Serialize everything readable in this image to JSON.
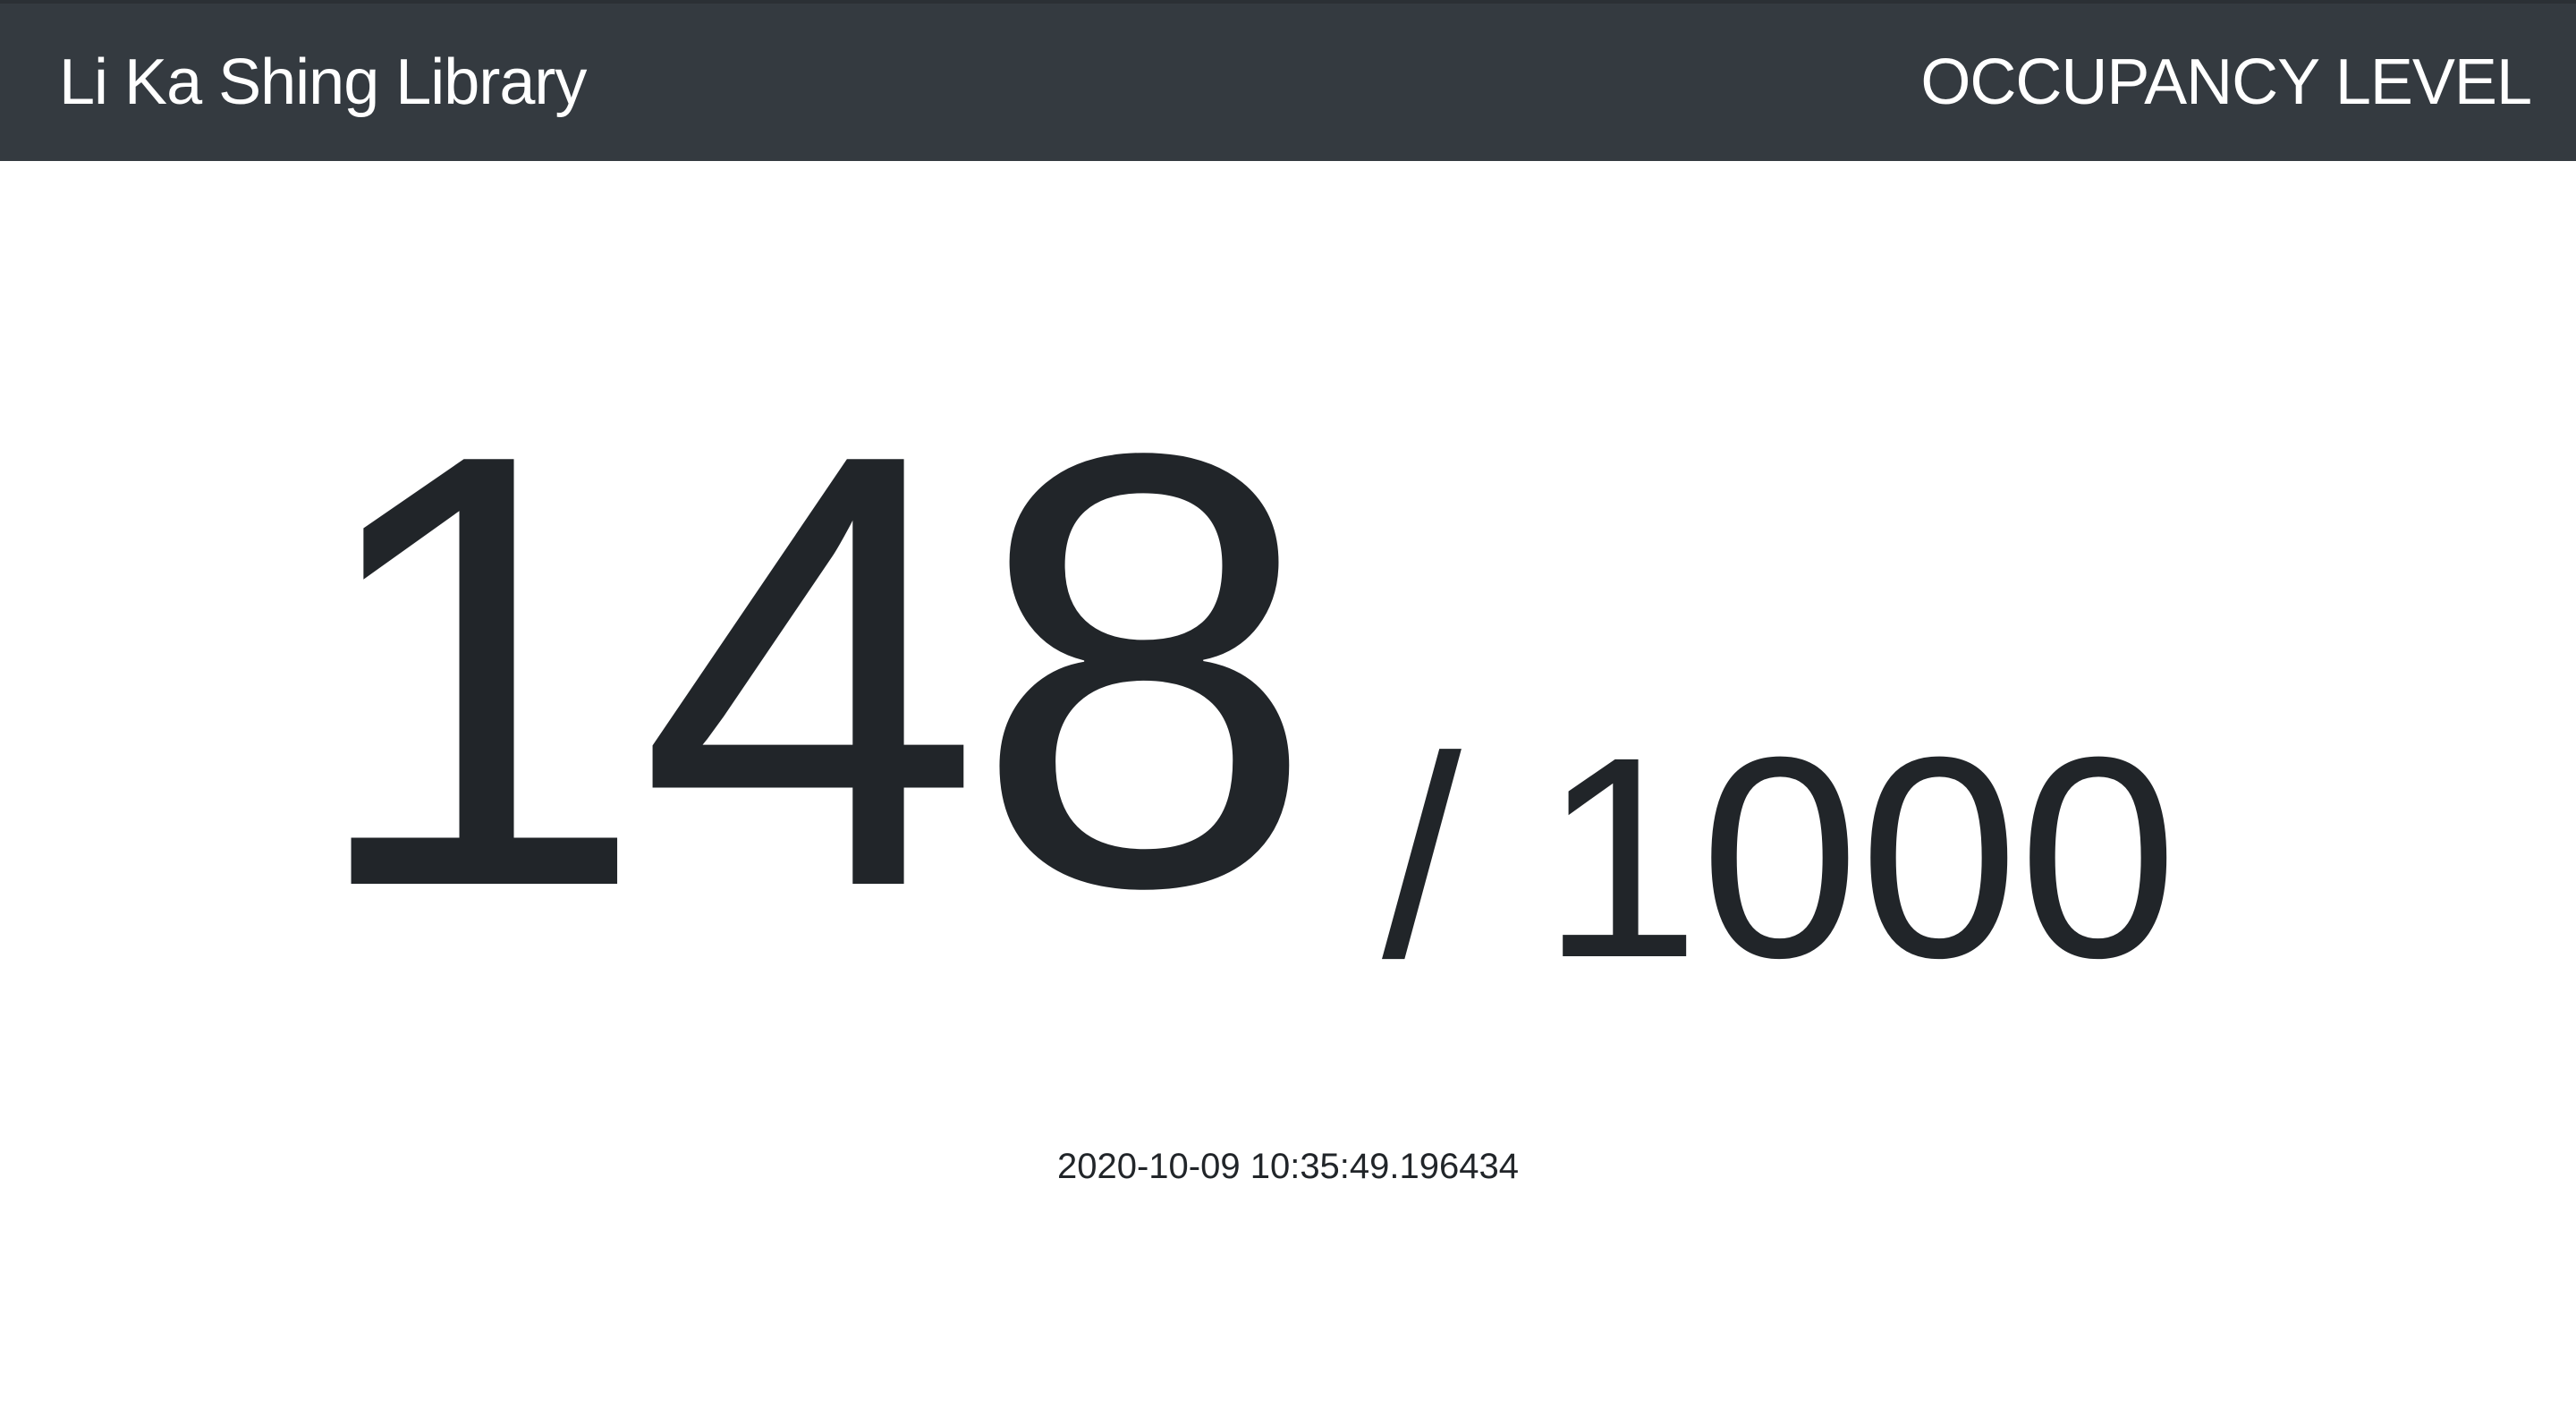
{
  "navbar": {
    "brand": "Li Ka Shing Library",
    "section": "OCCUPANCY LEVEL"
  },
  "occupancy": {
    "current": "148",
    "capacity": "/ 1000",
    "current_value": 148,
    "capacity_value": 1000
  },
  "timestamp": "2020-10-09 10:35:49.196434",
  "colors": {
    "navbar_bg": "#343a40",
    "navbar_text": "#ffffff",
    "body_text": "#212529",
    "background": "#ffffff"
  }
}
